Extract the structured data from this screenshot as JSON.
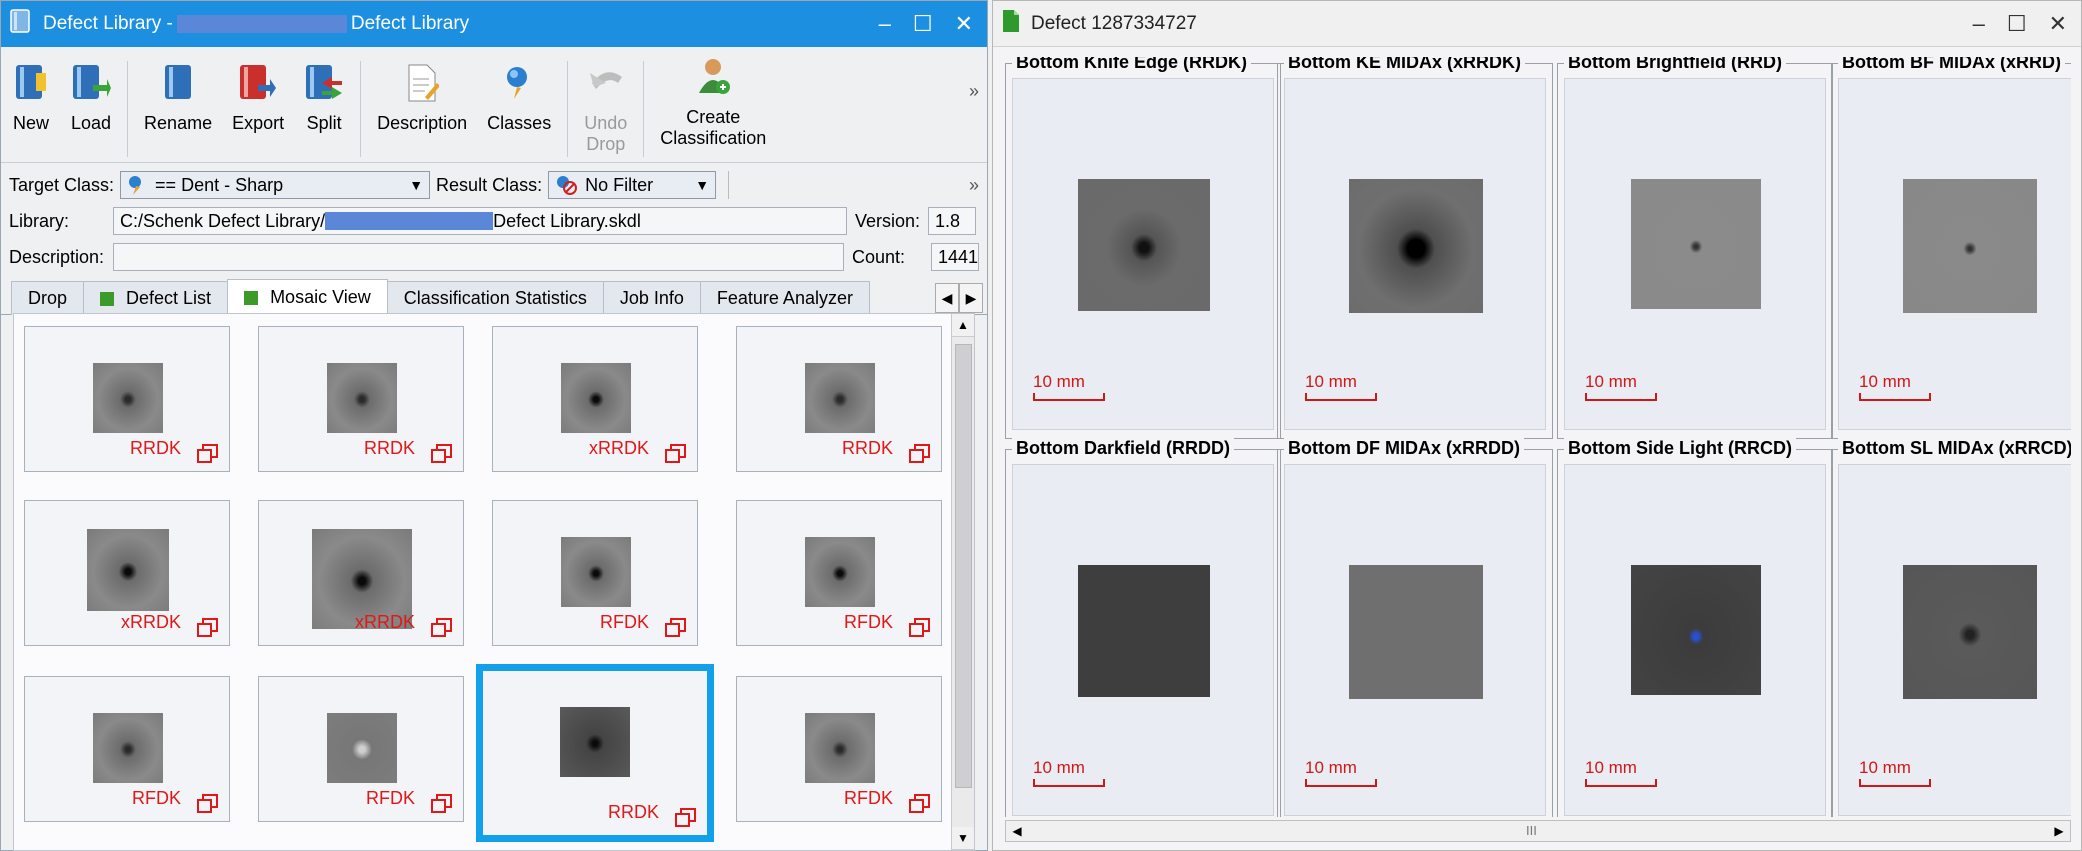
{
  "left_window": {
    "title_prefix": "Defect Library -",
    "title_suffix": "Defect Library",
    "controls": {
      "minimize": "–",
      "maximize": "☐",
      "close": "✕"
    }
  },
  "toolbar": {
    "new": "New",
    "load": "Load",
    "rename": "Rename",
    "export": "Export",
    "split": "Split",
    "description": "Description",
    "classes": "Classes",
    "undo_drop_1": "Undo",
    "undo_drop_2": "Drop",
    "create_1": "Create",
    "create_2": "Classification",
    "more": "»"
  },
  "filters": {
    "target_label": "Target Class:",
    "target_value": "== Dent - Sharp",
    "result_label": "Result Class:",
    "result_value": "No Filter",
    "more": "»"
  },
  "info": {
    "library_label": "Library:",
    "library_prefix": "C:/Schenk Defect Library/",
    "library_suffix": "Defect Library.skdl",
    "version_label": "Version:",
    "version_value": "1.8",
    "description_label": "Description:",
    "description_value": "",
    "count_label": "Count:",
    "count_value": "1441"
  },
  "tabs": [
    "Drop",
    "Defect List",
    "Mosaic View",
    "Classification Statistics",
    "Job Info",
    "Feature Analyzer"
  ],
  "mosaic": {
    "tiles": [
      "RRDK",
      "RRDK",
      "xRRDK",
      "RRDK",
      "xRRDK",
      "xRRDK",
      "RFDK",
      "RFDK",
      "RFDK",
      "RFDK",
      "RRDK",
      "RFDK"
    ],
    "selected_index": 10
  },
  "right_window": {
    "title": "Defect 1287334727",
    "controls": {
      "minimize": "–",
      "maximize": "☐",
      "close": "✕"
    },
    "scale_label": "10 mm",
    "hscroll_grip": "III",
    "views": [
      "Bottom Knife Edge (RRDK)",
      "Bottom KE MIDAx (xRRDK)",
      "Bottom Brightfield (RRD)",
      "Bottom BF MIDAx (xRRD)",
      "Bottom Darkfield (RRDD)",
      "Bottom DF MIDAx (xRRDD)",
      "Bottom Side Light (RRCD)",
      "Bottom SL MIDAx (xRRCD)"
    ]
  },
  "colors": {
    "title_blue": "#1c8fe0",
    "selection_blue": "#12a0ea",
    "label_red": "#e01818"
  }
}
